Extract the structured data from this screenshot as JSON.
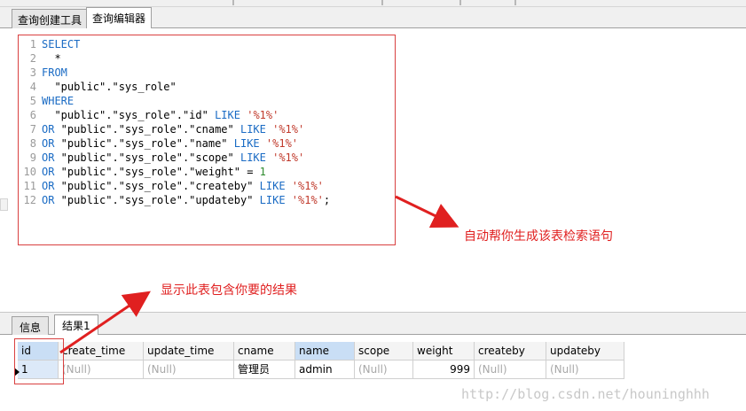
{
  "tabs": {
    "top": [
      {
        "label": "查询创建工具",
        "active": false
      },
      {
        "label": "查询编辑器",
        "active": true
      }
    ],
    "bottom": [
      {
        "label": "信息",
        "active": false
      },
      {
        "label": "结果1",
        "active": true
      }
    ]
  },
  "editor": {
    "lines": [
      {
        "n": "1",
        "segments": [
          {
            "t": "SELECT",
            "c": "kw"
          }
        ]
      },
      {
        "n": "2",
        "segments": [
          {
            "t": "  *",
            "c": "code"
          }
        ]
      },
      {
        "n": "3",
        "segments": [
          {
            "t": "FROM",
            "c": "kw"
          }
        ]
      },
      {
        "n": "4",
        "segments": [
          {
            "t": "  \"public\".\"sys_role\"",
            "c": "code"
          }
        ]
      },
      {
        "n": "5",
        "segments": [
          {
            "t": "WHERE",
            "c": "kw"
          }
        ]
      },
      {
        "n": "6",
        "segments": [
          {
            "t": "  \"public\".\"sys_role\".\"id\" ",
            "c": "code"
          },
          {
            "t": "LIKE",
            "c": "kw"
          },
          {
            "t": " ",
            "c": "code"
          },
          {
            "t": "'%1%'",
            "c": "str"
          }
        ]
      },
      {
        "n": "7",
        "segments": [
          {
            "t": "OR",
            "c": "kw"
          },
          {
            "t": " \"public\".\"sys_role\".\"cname\" ",
            "c": "code"
          },
          {
            "t": "LIKE",
            "c": "kw"
          },
          {
            "t": " ",
            "c": "code"
          },
          {
            "t": "'%1%'",
            "c": "str"
          }
        ]
      },
      {
        "n": "8",
        "segments": [
          {
            "t": "OR",
            "c": "kw"
          },
          {
            "t": " \"public\".\"sys_role\".\"name\" ",
            "c": "code"
          },
          {
            "t": "LIKE",
            "c": "kw"
          },
          {
            "t": " ",
            "c": "code"
          },
          {
            "t": "'%1%'",
            "c": "str"
          }
        ]
      },
      {
        "n": "9",
        "segments": [
          {
            "t": "OR",
            "c": "kw"
          },
          {
            "t": " \"public\".\"sys_role\".\"scope\" ",
            "c": "code"
          },
          {
            "t": "LIKE",
            "c": "kw"
          },
          {
            "t": " ",
            "c": "code"
          },
          {
            "t": "'%1%'",
            "c": "str"
          }
        ]
      },
      {
        "n": "10",
        "segments": [
          {
            "t": "OR",
            "c": "kw"
          },
          {
            "t": " \"public\".\"sys_role\".\"weight\" = ",
            "c": "code"
          },
          {
            "t": "1",
            "c": "num"
          }
        ]
      },
      {
        "n": "11",
        "segments": [
          {
            "t": "OR",
            "c": "kw"
          },
          {
            "t": " \"public\".\"sys_role\".\"createby\" ",
            "c": "code"
          },
          {
            "t": "LIKE",
            "c": "kw"
          },
          {
            "t": " ",
            "c": "code"
          },
          {
            "t": "'%1%'",
            "c": "str"
          }
        ]
      },
      {
        "n": "12",
        "segments": [
          {
            "t": "OR",
            "c": "kw"
          },
          {
            "t": " \"public\".\"sys_role\".\"updateby\" ",
            "c": "code"
          },
          {
            "t": "LIKE",
            "c": "kw"
          },
          {
            "t": " ",
            "c": "code"
          },
          {
            "t": "'%1%'",
            "c": "str"
          },
          {
            "t": ";",
            "c": "code"
          }
        ]
      }
    ]
  },
  "annotations": {
    "auto_generate": "自动帮你生成该表检索语句",
    "result_note": "显示此表包含你要的结果"
  },
  "grid": {
    "columns": [
      "id",
      "create_time",
      "update_time",
      "cname",
      "name",
      "scope",
      "weight",
      "createby",
      "updateby"
    ],
    "rows": [
      [
        "1",
        "(Null)",
        "(Null)",
        "管理员",
        "admin",
        "(Null)",
        "999",
        "(Null)",
        "(Null)"
      ]
    ]
  },
  "watermark": "http://blog.csdn.net/houninghhh",
  "colors": {
    "annotation": "#e02020",
    "keyword": "#1a6bc4",
    "string": "#c0392b",
    "number": "#2e8b2e",
    "selected_header": "#c9def5"
  }
}
